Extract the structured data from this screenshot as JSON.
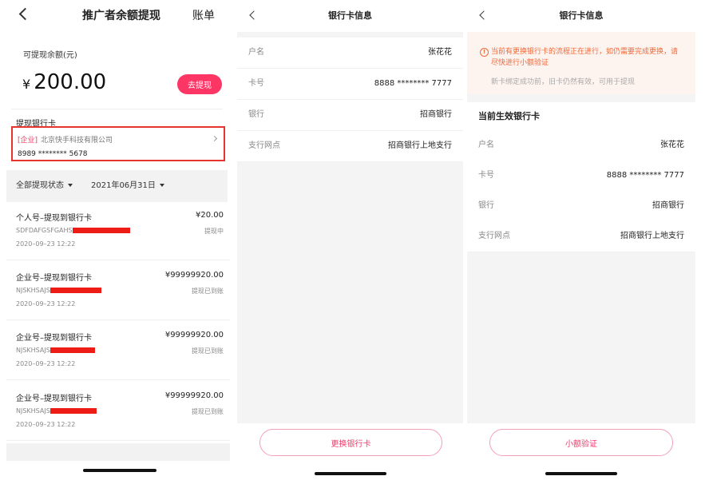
{
  "screen1": {
    "nav": {
      "title": "推广者余额提现",
      "bill_label": "账单"
    },
    "balance": {
      "label": "可提现余额(元)",
      "currency": "¥",
      "amount": "200.00",
      "withdraw_button": "去提现"
    },
    "card": {
      "section_label": "提现银行卡",
      "tag": "[企业]",
      "company": "北京快手科技有限公司",
      "number": "8989 ******** 5678"
    },
    "filters": {
      "status": "全部提现状态",
      "date": "2021年06月31日"
    },
    "transactions": [
      {
        "title": "个人号–提现到银行卡",
        "amount": "¥20.00",
        "id": "SDFDAFGSFGAHS",
        "status": "提现中",
        "time": "2020–09–23 12:22"
      },
      {
        "title": "企业号–提现到银行卡",
        "amount": "¥99999920.00",
        "id": "NJSKHSAJS",
        "status": "提现已到账",
        "time": "2020–09–23 12:22"
      },
      {
        "title": "企业号–提现到银行卡",
        "amount": "¥99999920.00",
        "id": "NJSKHSAJS",
        "status": "提现已到账",
        "time": "2020–09–23 12:22"
      },
      {
        "title": "企业号–提现到银行卡",
        "amount": "¥99999920.00",
        "id": "NJSKHSAJS",
        "status": "提现已到账",
        "time": "2020–09–23 12:22"
      }
    ]
  },
  "screen2": {
    "nav": {
      "title": "银行卡信息"
    },
    "rows": [
      {
        "label": "户名",
        "value": "张花花"
      },
      {
        "label": "卡号",
        "value": "8888 ******** 7777"
      },
      {
        "label": "银行",
        "value": "招商银行"
      },
      {
        "label": "支行网点",
        "value": "招商银行上地支行"
      }
    ],
    "button": "更换银行卡"
  },
  "screen3": {
    "nav": {
      "title": "银行卡信息"
    },
    "notice": {
      "icon": "!",
      "text": "当前有更换银行卡的流程正在进行，如仍需要完成更换，请尽快进行小额验证",
      "sub": "新卡绑定成功前，旧卡仍然有效，可用于提现"
    },
    "section_title": "当前生效银行卡",
    "rows": [
      {
        "label": "户名",
        "value": "张花花"
      },
      {
        "label": "卡号",
        "value": "8888 ******** 7777"
      },
      {
        "label": "银行",
        "value": "招商银行"
      },
      {
        "label": "支行网点",
        "value": "招商银行上地支行"
      }
    ],
    "button": "小额验证"
  },
  "colors": {
    "accent": "#fe3666",
    "highlight_border": "#e6352f",
    "notice_text": "#ef6a3a",
    "redaction": "#ee1c16"
  }
}
